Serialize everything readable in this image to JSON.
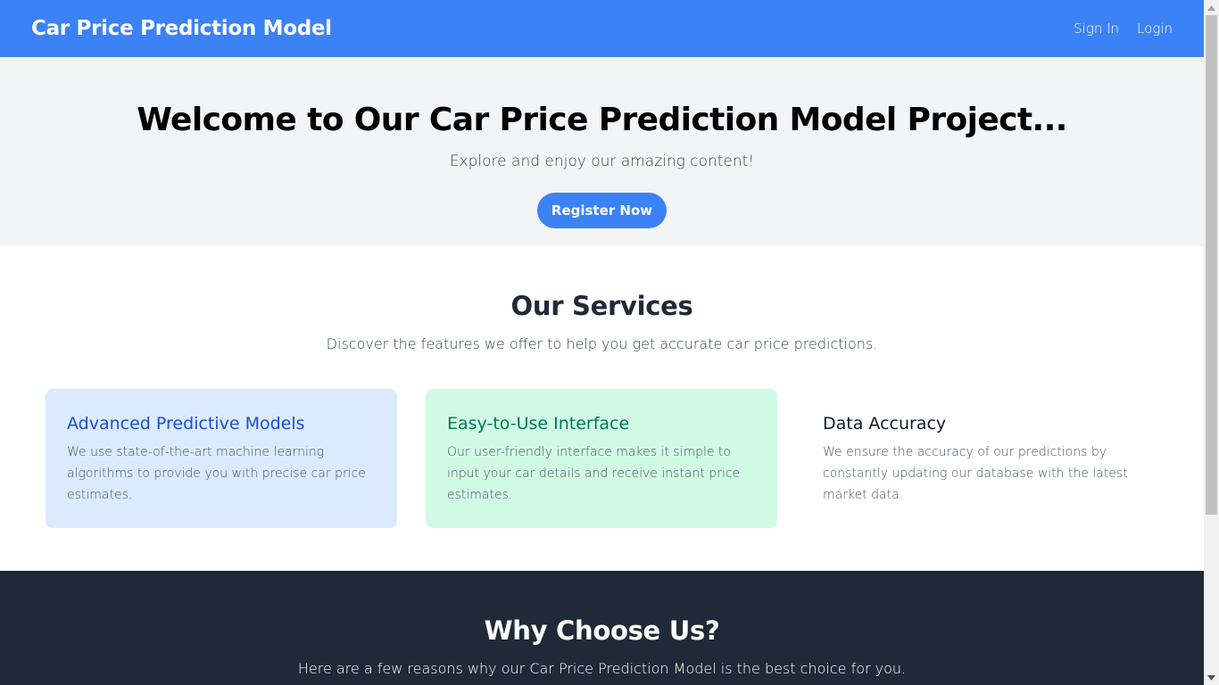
{
  "navbar": {
    "brand": "Car Price Prediction Model",
    "links": [
      "Sign In",
      "Login"
    ]
  },
  "hero": {
    "title": "Welcome to Our Car Price Prediction Model Project...",
    "subtitle": "Explore and enjoy our amazing content!",
    "cta_label": "Register Now"
  },
  "services": {
    "title": "Our Services",
    "subtitle": "Discover the features we offer to help you get accurate car price predictions.",
    "cards": [
      {
        "title": "Advanced Predictive Models",
        "text": "We use state-of-the-art machine learning algorithms to provide you with precise car price estimates."
      },
      {
        "title": "Easy-to-Use Interface",
        "text": "Our user-friendly interface makes it simple to input your car details and receive instant price estimates."
      },
      {
        "title": "Data Accuracy",
        "text": "We ensure the accuracy of our predictions by constantly updating our database with the latest market data."
      }
    ]
  },
  "why": {
    "title": "Why Choose Us?",
    "subtitle": "Here are a few reasons why our Car Price Prediction Model is the best choice for you."
  },
  "colors": {
    "primary": "#3b82f6",
    "hero_bg": "#f3f4f6",
    "dark_bg": "#1f2937",
    "card_blue": "#dbeafe",
    "card_green": "#d1fae5"
  },
  "icons": {
    "scroll_up": "scroll-up-arrow-icon",
    "scroll_down": "scroll-down-arrow-icon"
  }
}
